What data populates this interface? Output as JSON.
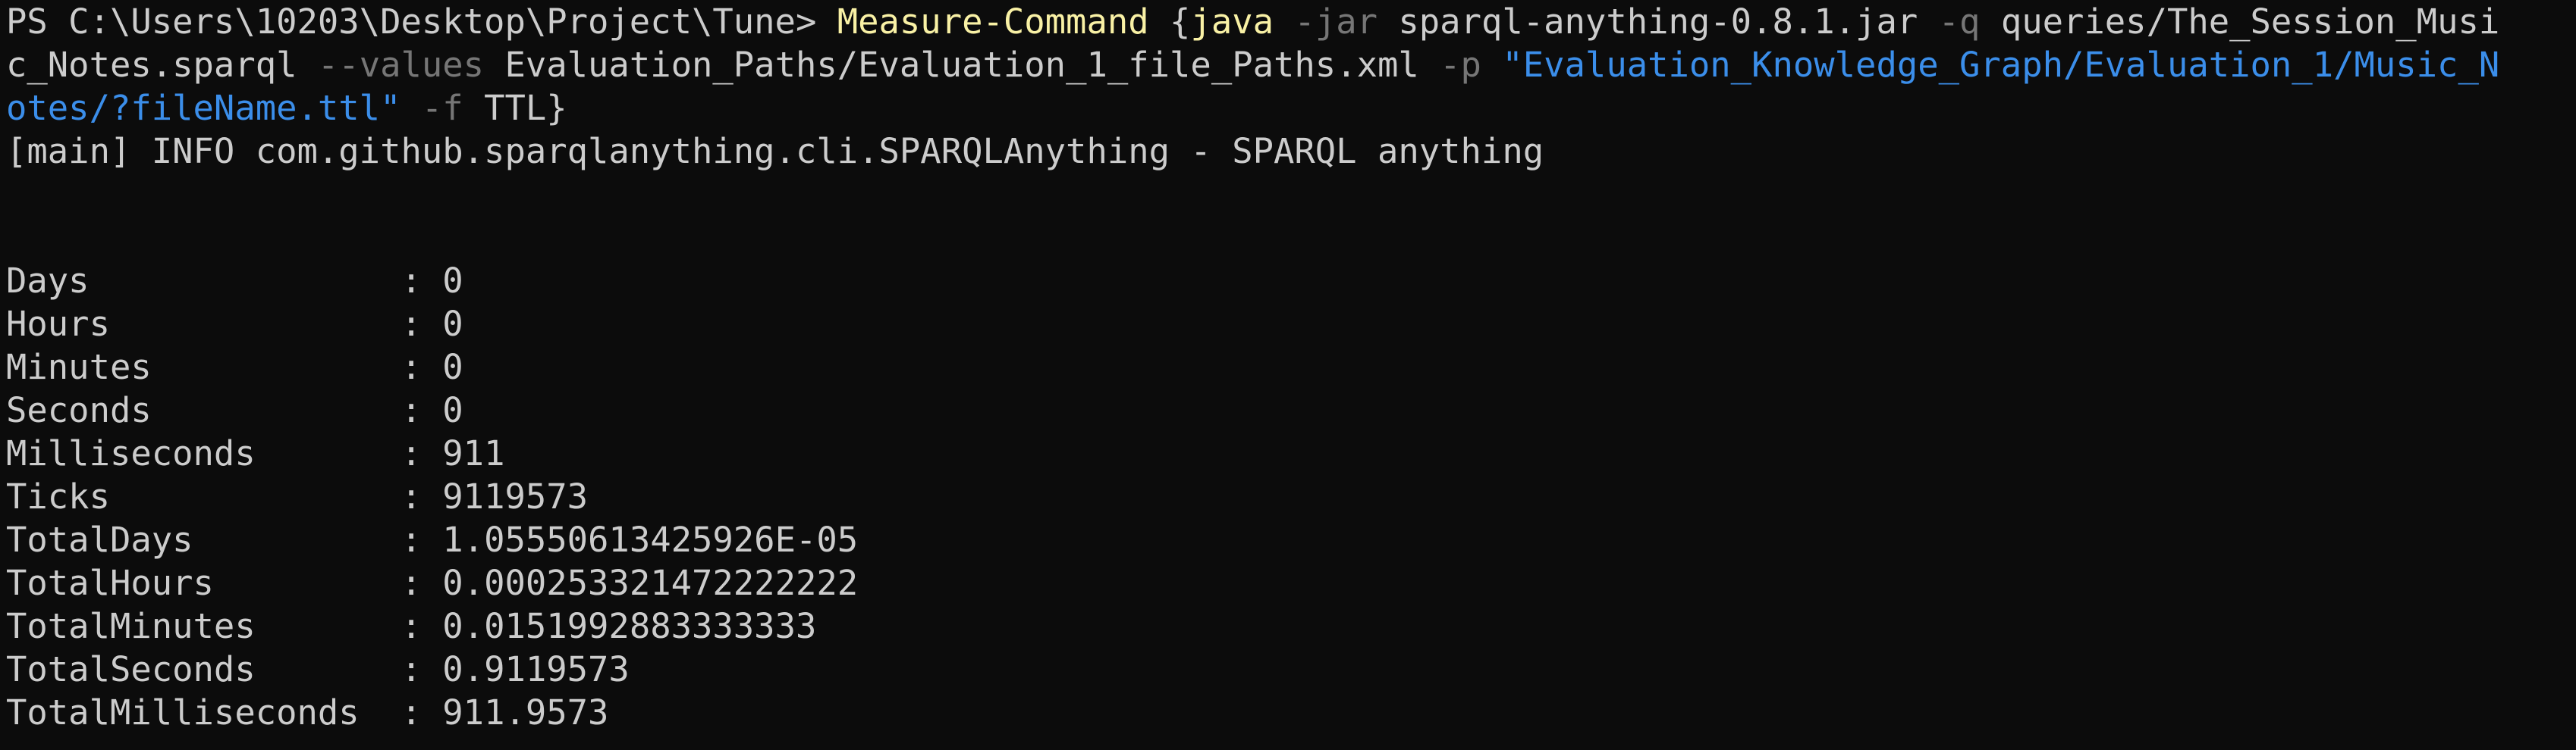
{
  "prompt": {
    "text": "PS C:\\Users\\10203\\Desktop\\Project\\Tune> "
  },
  "command": {
    "name": "Measure-Command",
    "open_brace": " {",
    "exe": "java",
    "sp1": " ",
    "flag_jar": "-jar",
    "jar_arg": " sparql-anything-0.8.1.jar ",
    "flag_q": "-q",
    "q_line1": " queries/The_Session_Musi",
    "q_line2": "c_Notes.sparql ",
    "flag_values": "--values",
    "values_arg": " Evaluation_Paths/Evaluation_1_file_Paths.xml ",
    "flag_p": "-p",
    "sp2": " ",
    "p_line2": "\"Evaluation_Knowledge_Graph/Evaluation_1/Music_N",
    "p_line3": "otes/?fileName.ttl\"",
    "sp3": " ",
    "flag_f": "-f",
    "f_arg": " TTL}"
  },
  "log": {
    "line": "[main] INFO com.github.sparqlanything.cli.SPARQLAnything - SPARQL anything"
  },
  "results": [
    {
      "key": "Days              ",
      "sep": " : ",
      "value": "0"
    },
    {
      "key": "Hours             ",
      "sep": " : ",
      "value": "0"
    },
    {
      "key": "Minutes           ",
      "sep": " : ",
      "value": "0"
    },
    {
      "key": "Seconds           ",
      "sep": " : ",
      "value": "0"
    },
    {
      "key": "Milliseconds      ",
      "sep": " : ",
      "value": "911"
    },
    {
      "key": "Ticks             ",
      "sep": " : ",
      "value": "9119573"
    },
    {
      "key": "TotalDays         ",
      "sep": " : ",
      "value": "1.05550613425926E-05"
    },
    {
      "key": "TotalHours        ",
      "sep": " : ",
      "value": "0.000253321472222222"
    },
    {
      "key": "TotalMinutes      ",
      "sep": " : ",
      "value": "0.0151992883333333"
    },
    {
      "key": "TotalSeconds      ",
      "sep": " : ",
      "value": "0.9119573"
    },
    {
      "key": "TotalMilliseconds ",
      "sep": " : ",
      "value": "911.9573"
    }
  ],
  "colors": {
    "background": "#0c0c0c",
    "foreground": "#cccccc",
    "cmdlet": "#f9f1a5",
    "parameter": "#767676",
    "string": "#3b8eea"
  }
}
